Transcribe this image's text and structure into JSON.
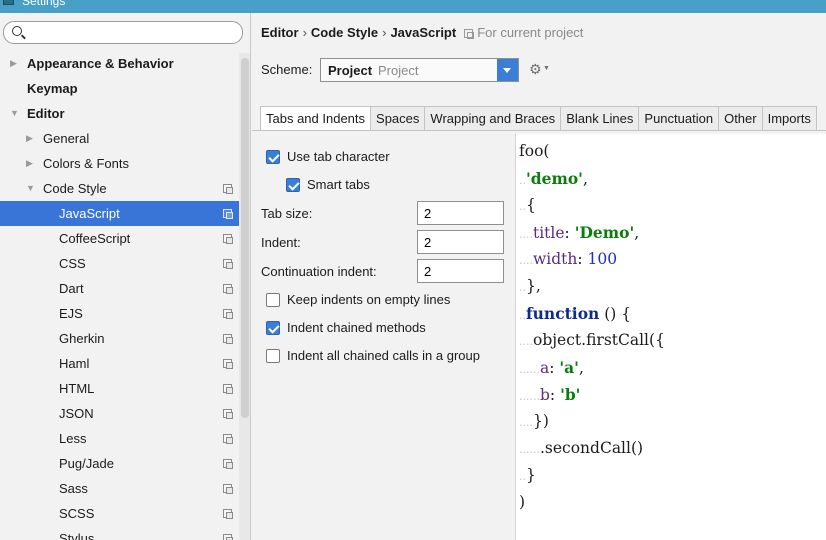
{
  "window": {
    "title": "Settings"
  },
  "search": {
    "value": "",
    "placeholder": ""
  },
  "tree": [
    {
      "label": "Appearance & Behavior",
      "level": 0,
      "expanded": false,
      "has_arrow": true,
      "bold": true,
      "selected": false,
      "copy_icon": false
    },
    {
      "label": "Keymap",
      "level": 0,
      "expanded": false,
      "has_arrow": false,
      "bold": true,
      "selected": false,
      "copy_icon": false
    },
    {
      "label": "Editor",
      "level": 0,
      "expanded": true,
      "has_arrow": true,
      "bold": true,
      "selected": false,
      "copy_icon": false
    },
    {
      "label": "General",
      "level": 1,
      "expanded": false,
      "has_arrow": true,
      "bold": false,
      "selected": false,
      "copy_icon": false
    },
    {
      "label": "Colors & Fonts",
      "level": 1,
      "expanded": false,
      "has_arrow": true,
      "bold": false,
      "selected": false,
      "copy_icon": false
    },
    {
      "label": "Code Style",
      "level": 1,
      "expanded": true,
      "has_arrow": true,
      "bold": false,
      "selected": false,
      "copy_icon": true
    },
    {
      "label": "JavaScript",
      "level": 2,
      "expanded": false,
      "has_arrow": false,
      "bold": false,
      "selected": true,
      "copy_icon": true
    },
    {
      "label": "CoffeeScript",
      "level": 2,
      "expanded": false,
      "has_arrow": false,
      "bold": false,
      "selected": false,
      "copy_icon": true
    },
    {
      "label": "CSS",
      "level": 2,
      "expanded": false,
      "has_arrow": false,
      "bold": false,
      "selected": false,
      "copy_icon": true
    },
    {
      "label": "Dart",
      "level": 2,
      "expanded": false,
      "has_arrow": false,
      "bold": false,
      "selected": false,
      "copy_icon": true
    },
    {
      "label": "EJS",
      "level": 2,
      "expanded": false,
      "has_arrow": false,
      "bold": false,
      "selected": false,
      "copy_icon": true
    },
    {
      "label": "Gherkin",
      "level": 2,
      "expanded": false,
      "has_arrow": false,
      "bold": false,
      "selected": false,
      "copy_icon": true
    },
    {
      "label": "Haml",
      "level": 2,
      "expanded": false,
      "has_arrow": false,
      "bold": false,
      "selected": false,
      "copy_icon": true
    },
    {
      "label": "HTML",
      "level": 2,
      "expanded": false,
      "has_arrow": false,
      "bold": false,
      "selected": false,
      "copy_icon": true
    },
    {
      "label": "JSON",
      "level": 2,
      "expanded": false,
      "has_arrow": false,
      "bold": false,
      "selected": false,
      "copy_icon": true
    },
    {
      "label": "Less",
      "level": 2,
      "expanded": false,
      "has_arrow": false,
      "bold": false,
      "selected": false,
      "copy_icon": true
    },
    {
      "label": "Pug/Jade",
      "level": 2,
      "expanded": false,
      "has_arrow": false,
      "bold": false,
      "selected": false,
      "copy_icon": true
    },
    {
      "label": "Sass",
      "level": 2,
      "expanded": false,
      "has_arrow": false,
      "bold": false,
      "selected": false,
      "copy_icon": true
    },
    {
      "label": "SCSS",
      "level": 2,
      "expanded": false,
      "has_arrow": false,
      "bold": false,
      "selected": false,
      "copy_icon": true
    },
    {
      "label": "Stylus",
      "level": 2,
      "expanded": false,
      "has_arrow": false,
      "bold": false,
      "selected": false,
      "copy_icon": true
    }
  ],
  "breadcrumb": {
    "items": [
      "Editor",
      "Code Style",
      "JavaScript"
    ],
    "separator": "›",
    "scope_note": "For current project"
  },
  "scheme": {
    "label": "Scheme:",
    "name": "Project",
    "type": "Project"
  },
  "tabs": [
    {
      "label": "Tabs and Indents",
      "active": true
    },
    {
      "label": "Spaces",
      "active": false
    },
    {
      "label": "Wrapping and Braces",
      "active": false
    },
    {
      "label": "Blank Lines",
      "active": false
    },
    {
      "label": "Punctuation",
      "active": false
    },
    {
      "label": "Other",
      "active": false
    },
    {
      "label": "Imports",
      "active": false
    }
  ],
  "options": {
    "use_tab_character": {
      "label": "Use tab character",
      "checked": true
    },
    "smart_tabs": {
      "label": "Smart tabs",
      "checked": true
    },
    "keep_indents_empty": {
      "label": "Keep indents on empty lines",
      "checked": false
    },
    "indent_chained_methods": {
      "label": "Indent chained methods",
      "checked": true
    },
    "indent_all_chained_calls": {
      "label": "Indent all chained calls in a group",
      "checked": false
    }
  },
  "fields": {
    "tab_size": {
      "label": "Tab size:",
      "value": "2"
    },
    "indent": {
      "label": "Indent:",
      "value": "2"
    },
    "continuation_indent": {
      "label": "Continuation indent:",
      "value": "2"
    }
  },
  "preview": {
    "lines": [
      {
        "ws": "",
        "tokens": [
          {
            "text": "foo(",
            "kind": "plain"
          }
        ]
      },
      {
        "ws": "..",
        "tokens": [
          {
            "text": "'demo'",
            "kind": "str"
          },
          {
            "text": ",",
            "kind": "plain"
          }
        ]
      },
      {
        "ws": "..",
        "tokens": [
          {
            "text": "{",
            "kind": "plain"
          }
        ]
      },
      {
        "ws": "....",
        "tokens": [
          {
            "text": "title",
            "kind": "prop"
          },
          {
            "text": ": ",
            "kind": "plain"
          },
          {
            "text": "'Demo'",
            "kind": "str"
          },
          {
            "text": ",",
            "kind": "plain"
          }
        ]
      },
      {
        "ws": "....",
        "tokens": [
          {
            "text": "width",
            "kind": "prop"
          },
          {
            "text": ": ",
            "kind": "plain"
          },
          {
            "text": "100",
            "kind": "num"
          }
        ]
      },
      {
        "ws": "..",
        "tokens": [
          {
            "text": "},",
            "kind": "plain"
          }
        ]
      },
      {
        "ws": "..",
        "tokens": [
          {
            "text": "function",
            "kind": "kw"
          },
          {
            "text": " () {",
            "kind": "plain"
          }
        ]
      },
      {
        "ws": "....",
        "tokens": [
          {
            "text": "object.firstCall({",
            "kind": "plain"
          }
        ]
      },
      {
        "ws": "......",
        "tokens": [
          {
            "text": "a",
            "kind": "prop"
          },
          {
            "text": ": ",
            "kind": "plain"
          },
          {
            "text": "'a'",
            "kind": "str"
          },
          {
            "text": ",",
            "kind": "plain"
          }
        ]
      },
      {
        "ws": "......",
        "tokens": [
          {
            "text": "b",
            "kind": "prop"
          },
          {
            "text": ": ",
            "kind": "plain"
          },
          {
            "text": "'b'",
            "kind": "str"
          }
        ]
      },
      {
        "ws": "....",
        "tokens": [
          {
            "text": "})",
            "kind": "plain"
          }
        ]
      },
      {
        "ws": "......",
        "tokens": [
          {
            "text": ".secondCall()",
            "kind": "plain"
          }
        ]
      },
      {
        "ws": "..",
        "tokens": [
          {
            "text": "}",
            "kind": "plain"
          }
        ]
      },
      {
        "ws": "",
        "tokens": [
          {
            "text": ")",
            "kind": "plain"
          }
        ]
      }
    ]
  },
  "colors": {
    "titlebar": "#48a0c8",
    "selection": "#3875d7",
    "accent": "#3a7fd5",
    "string": "#0a7d0a",
    "keyword": "#0c2b8f",
    "number": "#1a2fd0",
    "whitespace_marker": "#c4c4c4"
  },
  "icons": {
    "search": "search-icon",
    "copy": "copy-scheme-icon",
    "gear": "gear-icon",
    "expand": "triangle-right-icon",
    "collapse": "triangle-down-icon"
  }
}
